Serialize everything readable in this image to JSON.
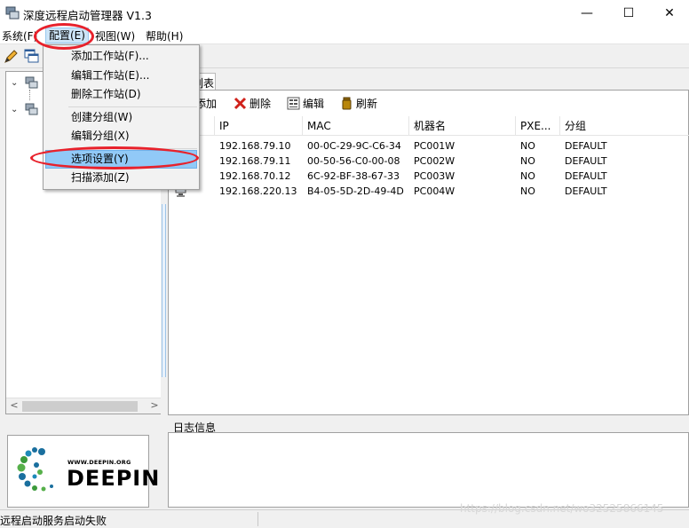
{
  "window": {
    "title": "深度远程启动管理器 V1.3",
    "controls": {
      "minimize": "—",
      "maximize": "☐",
      "close": "✕"
    }
  },
  "menubar": {
    "items": [
      {
        "label": "系统(F)"
      },
      {
        "label": "配置(E)"
      },
      {
        "label": "视图(W)"
      },
      {
        "label": "帮助(H)"
      }
    ]
  },
  "config_menu": {
    "items": [
      {
        "label": "添加工作站(F)..."
      },
      {
        "label": "编辑工作站(E)..."
      },
      {
        "label": "删除工作站(D)"
      },
      {
        "label": "创建分组(W)"
      },
      {
        "label": "编辑分组(X)"
      },
      {
        "label": "选项设置(Y)"
      },
      {
        "label": "扫描添加(Z)"
      }
    ],
    "highlighted": "选项设置(Y)"
  },
  "tab": {
    "label": "列表"
  },
  "list_toolbar": {
    "add": "添加",
    "delete": "删除",
    "edit": "编辑",
    "refresh": "刷新"
  },
  "table": {
    "columns": [
      "IP",
      "MAC",
      "机器名",
      "PXE...",
      "分组"
    ],
    "rows": [
      {
        "ip": "192.168.79.10",
        "mac": "00-0C-29-9C-C6-34",
        "name": "PC001W",
        "pxe": "NO",
        "group": "DEFAULT"
      },
      {
        "ip": "192.168.79.11",
        "mac": "00-50-56-C0-00-08",
        "name": "PC002W",
        "pxe": "NO",
        "group": "DEFAULT"
      },
      {
        "ip": "192.168.70.12",
        "mac": "6C-92-BF-38-67-33",
        "name": "PC003W",
        "pxe": "NO",
        "group": "DEFAULT"
      },
      {
        "ip": "192.168.220.13",
        "mac": "B4-05-5D-2D-49-4D",
        "name": "PC004W",
        "pxe": "NO",
        "group": "DEFAULT"
      }
    ]
  },
  "log": {
    "label": "日志信息"
  },
  "logo": {
    "url": "WWW.DEEPIN.ORG",
    "name": "DEEPIN"
  },
  "status": {
    "text": "远程启动服务启动失败"
  },
  "watermark": "https://blog.csdn.net/wo32525866145",
  "colors": {
    "highlight": "#91c9f7",
    "annotation": "#e8212b",
    "menu_hover": "#cce4f7"
  }
}
